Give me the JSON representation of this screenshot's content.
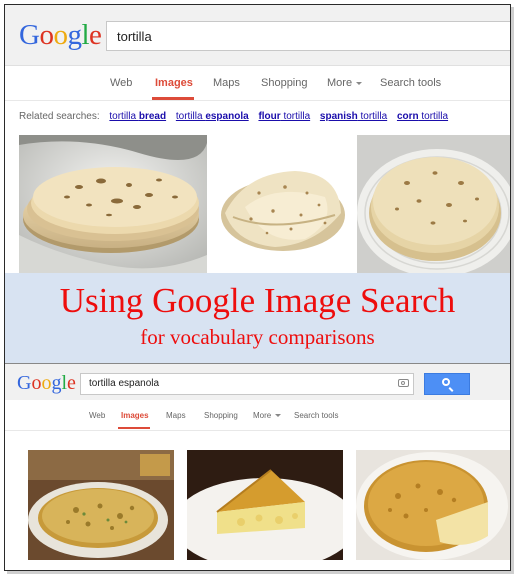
{
  "top": {
    "logo": "Google",
    "query": "tortilla",
    "tabs": [
      {
        "label": "Web",
        "active": false
      },
      {
        "label": "Images",
        "active": true
      },
      {
        "label": "Maps",
        "active": false
      },
      {
        "label": "Shopping",
        "active": false
      },
      {
        "label": "More",
        "active": false
      },
      {
        "label": "Search tools",
        "active": false
      }
    ],
    "related_label": "Related searches:",
    "related": [
      {
        "plain": "tortilla ",
        "bold": "bread"
      },
      {
        "plain": "tortilla ",
        "bold": "espanola"
      },
      {
        "plain": "",
        "bold": "flour",
        "suffix": " tortilla"
      },
      {
        "plain": "",
        "bold": "spanish",
        "suffix": " tortilla"
      },
      {
        "plain": "",
        "bold": "corn",
        "suffix": " tortilla"
      }
    ]
  },
  "banner": {
    "title": "Using Google Image Search",
    "subtitle": "for vocabulary comparisons"
  },
  "bottom": {
    "logo": "Google",
    "query": "tortilla espanola",
    "tabs": [
      {
        "label": "Web",
        "active": false
      },
      {
        "label": "Images",
        "active": true
      },
      {
        "label": "Maps",
        "active": false
      },
      {
        "label": "Shopping",
        "active": false
      },
      {
        "label": "More",
        "active": false
      },
      {
        "label": "Search tools",
        "active": false
      }
    ]
  },
  "colors": {
    "accent_red": "#dd4b39",
    "link_blue": "#1a0dab",
    "banner_text": "#ee0d0d",
    "banner_bg": "#d8e3f2",
    "search_button": "#4d8ff5"
  }
}
